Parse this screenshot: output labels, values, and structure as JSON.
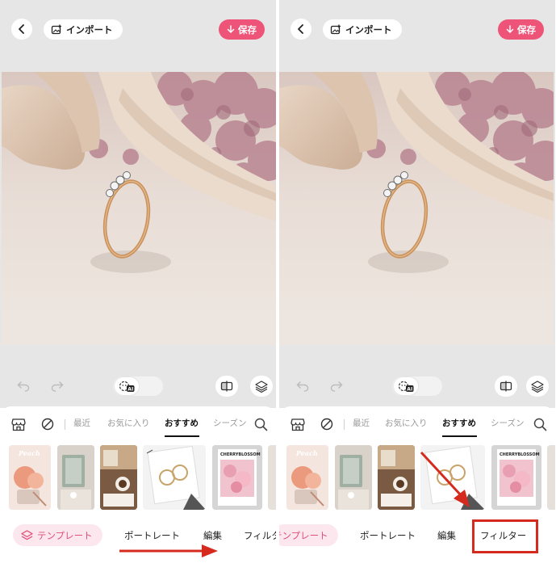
{
  "header": {
    "import_label": "インポート",
    "save_label": "保存"
  },
  "categories": {
    "recent": "最近",
    "favorites": "お気に入り",
    "recommended": "おすすめ",
    "seasonal": "シーズン"
  },
  "thumbnails": {
    "peach_text": "Peach",
    "cherry_text": "CHERRYBLOSSOM"
  },
  "bottom_nav": {
    "template": "テンプレート",
    "portrait": "ポートレート",
    "edit": "編集",
    "filter": "フィルター"
  },
  "colors": {
    "accent": "#ee5478",
    "pill_background": "#fde7ef",
    "annotation_red": "#d52b1e",
    "editor_background": "#e6e6e6"
  }
}
